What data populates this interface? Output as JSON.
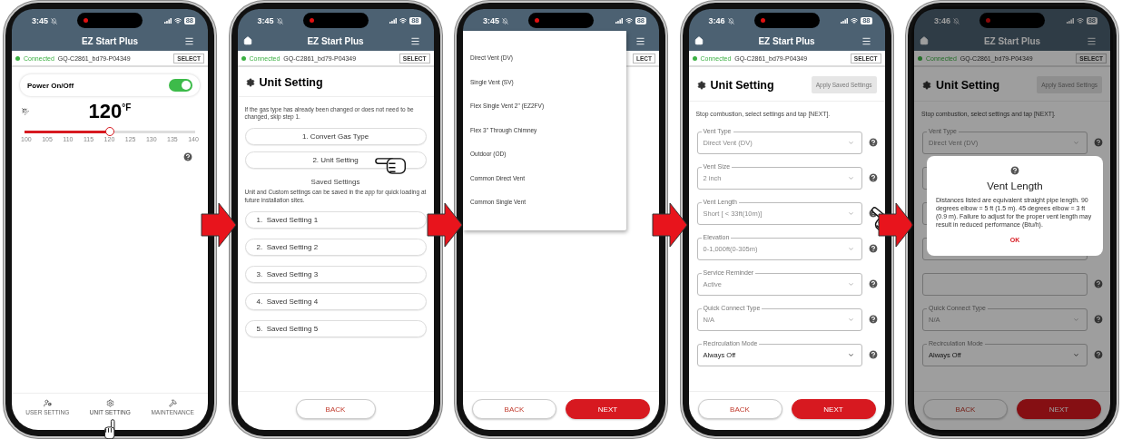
{
  "phones": [
    {
      "kind": "home",
      "time": "3:45",
      "battery": "88",
      "header": {
        "home": false,
        "title": "EZ Start Plus"
      },
      "connection": {
        "status": "Connected",
        "device": "GQ-C2861_bd79-P04349",
        "select": "SELECT"
      },
      "power": {
        "label": "Power On/Off",
        "on": true
      },
      "temperature": {
        "value": "120",
        "unit": "°F"
      },
      "slider": {
        "level": 0.5,
        "ticks": [
          "100",
          "105",
          "110",
          "115",
          "120",
          "125",
          "130",
          "135",
          "140"
        ]
      },
      "nav": [
        {
          "label": "USER SETTING",
          "tapped": false
        },
        {
          "label": "UNIT SETTING",
          "tapped": true
        },
        {
          "label": "MAINTENANCE",
          "tapped": false
        }
      ]
    },
    {
      "kind": "unit_menu",
      "time": "3:45",
      "battery": "88",
      "header": {
        "home": true,
        "title": "EZ Start Plus"
      },
      "connection": {
        "status": "Connected",
        "device": "GQ-C2861_bd79-P04349",
        "select": "SELECT"
      },
      "title": "Unit Setting",
      "intro": "If the gas type has already been changed or does not need to be changed, skip step 1.",
      "steps": [
        {
          "label": "1. Convert Gas Type",
          "tapped": false
        },
        {
          "label": "2. Unit Setting",
          "tapped": true
        }
      ],
      "saved_title": "Saved Settings",
      "saved_text": "Unit and Custom settings can be saved in the app for quick loading at future installation sites.",
      "saved": [
        {
          "number": "1.",
          "name": "Saved Setting 1"
        },
        {
          "number": "2.",
          "name": "Saved Setting 2"
        },
        {
          "number": "3.",
          "name": "Saved Setting 3"
        },
        {
          "number": "4.",
          "name": "Saved Setting 4"
        },
        {
          "number": "5.",
          "name": "Saved Setting 5"
        }
      ],
      "actions": {
        "back": "BACK"
      }
    },
    {
      "kind": "vent_type_menu",
      "time": "3:45",
      "battery": "88",
      "connection": {
        "select": "LECT"
      },
      "options": [
        "Direct Vent (DV)",
        "Single Vent (SV)",
        "Flex Single Vent 2\" (EZ2FV)",
        "Flex 3\" Through Chimney",
        "Outdoor (OD)",
        "Common Direct Vent",
        "Common Single Vent"
      ],
      "actions": {
        "back": "BACK",
        "next": "NEXT"
      }
    },
    {
      "kind": "unit_form",
      "time": "3:46",
      "battery": "88",
      "header": {
        "home": true,
        "title": "EZ Start Plus"
      },
      "connection": {
        "status": "Connected",
        "device": "GQ-C2861_bd79-P04349",
        "select": "SELECT"
      },
      "title": "Unit Setting",
      "apply": "Apply Saved Settings",
      "instruction": "Stop combustion, select settings and tap [NEXT].",
      "fields": [
        {
          "label": "Vent Type",
          "value": "Direct Vent (DV)",
          "disabled": true,
          "tapped": false
        },
        {
          "label": "Vent Size",
          "value": "2 inch",
          "disabled": true,
          "tapped": false
        },
        {
          "label": "Vent Length",
          "value": "Short [ < 33ft(10m)]",
          "disabled": true,
          "tapped": true
        },
        {
          "label": "Elevation",
          "value": "0-1,000ft(0-305m)",
          "disabled": true,
          "tapped": false
        },
        {
          "label": "Service Reminder",
          "value": "Active",
          "disabled": true,
          "tapped": false
        },
        {
          "label": "Quick Connect Type",
          "value": "N/A",
          "disabled": true,
          "tapped": false
        },
        {
          "label": "Recirculation Mode",
          "value": "Always Off",
          "disabled": false,
          "tapped": false
        }
      ],
      "actions": {
        "back": "BACK",
        "next": "NEXT"
      }
    },
    {
      "kind": "unit_form",
      "time": "3:46",
      "battery": "88",
      "dimmed": true,
      "header": {
        "home": true,
        "title": "EZ Start Plus"
      },
      "connection": {
        "status": "Connected",
        "device": "GQ-C2861_bd79-P04349",
        "select": "SELECT"
      },
      "title": "Unit Setting",
      "apply": "Apply Saved Settings",
      "instruction": "Stop combustion, select settings and tap [NEXT].",
      "fields": [
        {
          "label": "Vent Type",
          "value": "Direct Vent (DV)",
          "disabled": true,
          "tapped": false
        },
        {
          "covered": true
        },
        {
          "covered": true
        },
        {
          "covered": true
        },
        {
          "covered": true
        },
        {
          "label": "Quick Connect Type",
          "value": "N/A",
          "disabled": true,
          "tapped": false
        },
        {
          "label": "Recirculation Mode",
          "value": "Always Off",
          "disabled": false,
          "tapped": false
        }
      ],
      "actions": {
        "back": "BACK",
        "next": "NEXT"
      },
      "dialog": {
        "title": "Vent Length",
        "text": "Distances listed are equivalent straight pipe length. 90 degrees elbow = 5 ft (1.5 m). 45 degrees elbow = 3 ft (0.9 m). Failure to adjust for the proper vent length may result in reduced performance (Btu/h).",
        "ok": "OK"
      }
    }
  ]
}
